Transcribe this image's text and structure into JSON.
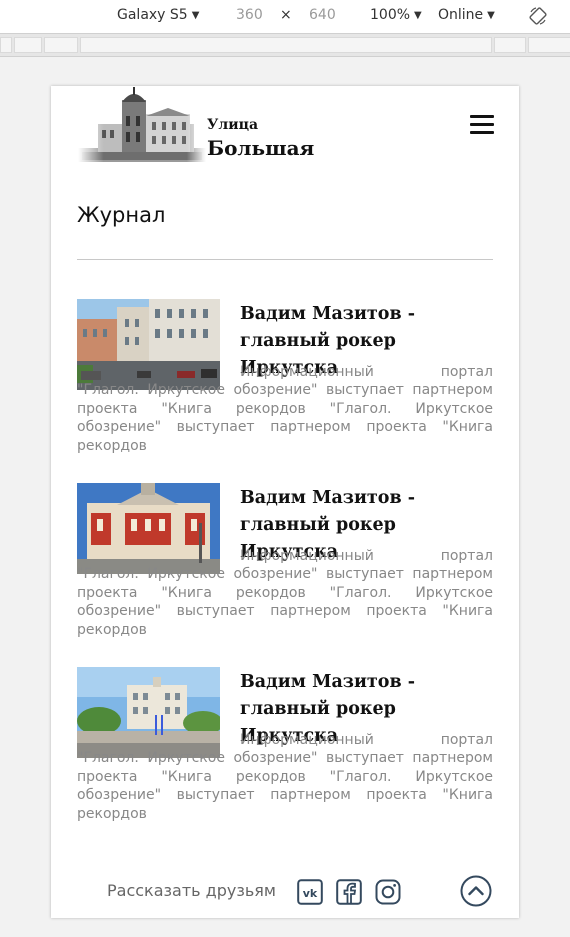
{
  "devtools": {
    "device": "Galaxy S5",
    "width": "360",
    "times": "×",
    "height": "640",
    "zoom": "100%",
    "network": "Online"
  },
  "header": {
    "brand_small": "Улица",
    "brand_big": "Большая"
  },
  "page": {
    "title": "Журнал"
  },
  "articles": [
    {
      "title_line1": "Вадим Мазитов -",
      "title_line2": "главный рокер Иркутска",
      "body": "Информационный портал \"Глагол. Иркутское обозрение\" выступает партнером проекта \"Книга рекордов \"Глагол. Иркутское обозрение\" выступает партнером проекта \"Книга рекордов"
    },
    {
      "title_line1": "Вадим Мазитов -",
      "title_line2": "главный рокер Иркутска",
      "body": "Информационный портал \"Глагол. Иркутское обозрение\" выступает партнером проекта \"Книга рекордов \"Глагол. Иркутское обозрение\" выступает партнером проекта \"Книга рекордов"
    },
    {
      "title_line1": "Вадим Мазитов -",
      "title_line2": "главный рокер Иркутска",
      "body": "Информационный портал \"Глагол. Иркутское обозрение\" выступает партнером проекта \"Книга рекордов \"Глагол. Иркутское обозрение\" выступает партнером проекта \"Книга рекордов"
    }
  ],
  "footer": {
    "share_label": "Рассказать друзьям",
    "icons": [
      "vk-icon",
      "facebook-icon",
      "instagram-icon",
      "scroll-up-icon"
    ]
  },
  "colors": {
    "accent": "#34495e",
    "muted_text": "#888888",
    "divider": "#c8c8c8"
  }
}
